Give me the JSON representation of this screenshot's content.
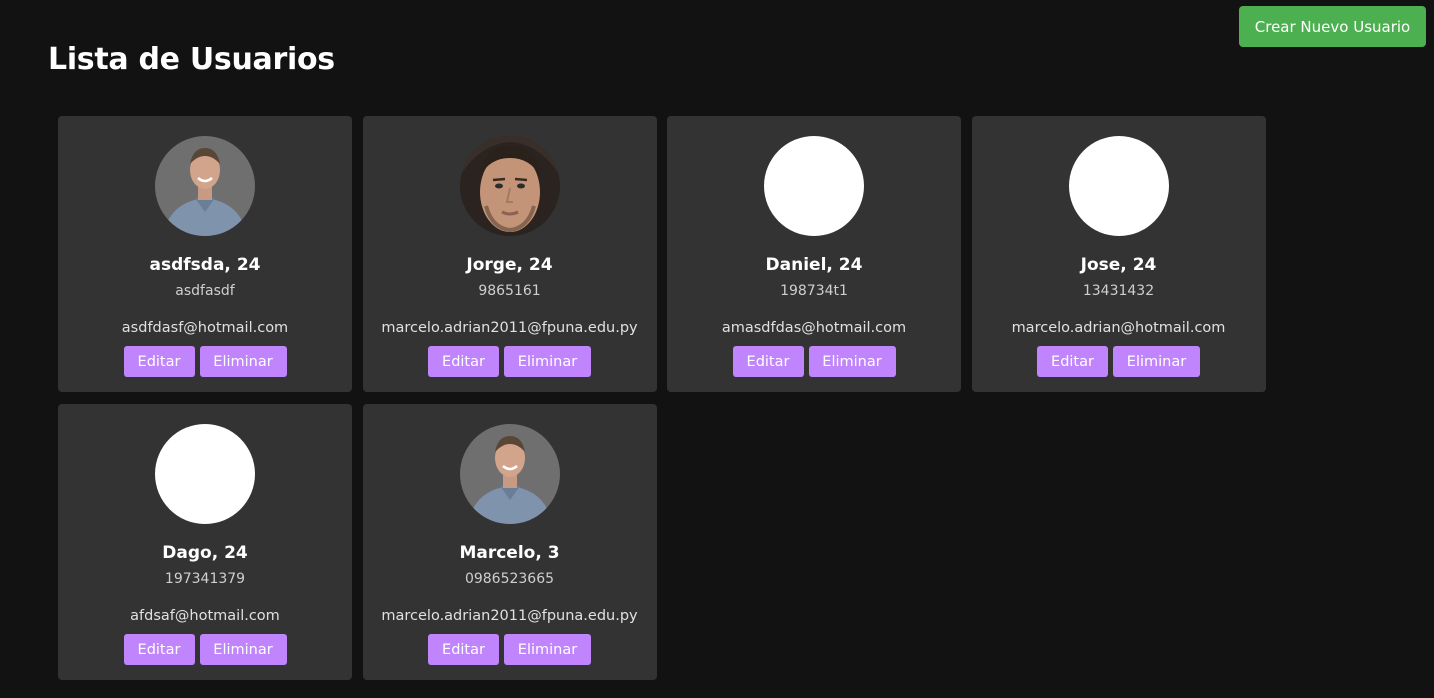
{
  "header": {
    "title": "Lista de Usuarios",
    "create_label": "Crear Nuevo Usuario"
  },
  "colors": {
    "background": "#121212",
    "card": "#333333",
    "primary_action": "#4caf50",
    "card_action": "#c084fc"
  },
  "users": [
    {
      "name": "asdfsda",
      "age": "24",
      "phone": "asdfasdf",
      "email": "asdfdasf@hotmail.com",
      "avatar": "photo-man-shirt",
      "edit_label": "Editar",
      "delete_label": "Eliminar"
    },
    {
      "name": "Jorge",
      "age": "24",
      "phone": "9865161",
      "email": "marcelo.adrian2011@fpuna.edu.py",
      "avatar": "photo-man-portrait",
      "edit_label": "Editar",
      "delete_label": "Eliminar"
    },
    {
      "name": "Daniel",
      "age": "24",
      "phone": "198734t1",
      "email": "amasdfdas@hotmail.com",
      "avatar": "blank",
      "edit_label": "Editar",
      "delete_label": "Eliminar"
    },
    {
      "name": "Jose",
      "age": "24",
      "phone": "13431432",
      "email": "marcelo.adrian@hotmail.com",
      "avatar": "blank",
      "edit_label": "Editar",
      "delete_label": "Eliminar"
    },
    {
      "name": "Dago",
      "age": "24",
      "phone": "197341379",
      "email": "afdsaf@hotmail.com",
      "avatar": "blank",
      "edit_label": "Editar",
      "delete_label": "Eliminar"
    },
    {
      "name": "Marcelo",
      "age": "3",
      "phone": "0986523665",
      "email": "marcelo.adrian2011@fpuna.edu.py",
      "avatar": "photo-man-shirt",
      "edit_label": "Editar",
      "delete_label": "Eliminar"
    }
  ]
}
